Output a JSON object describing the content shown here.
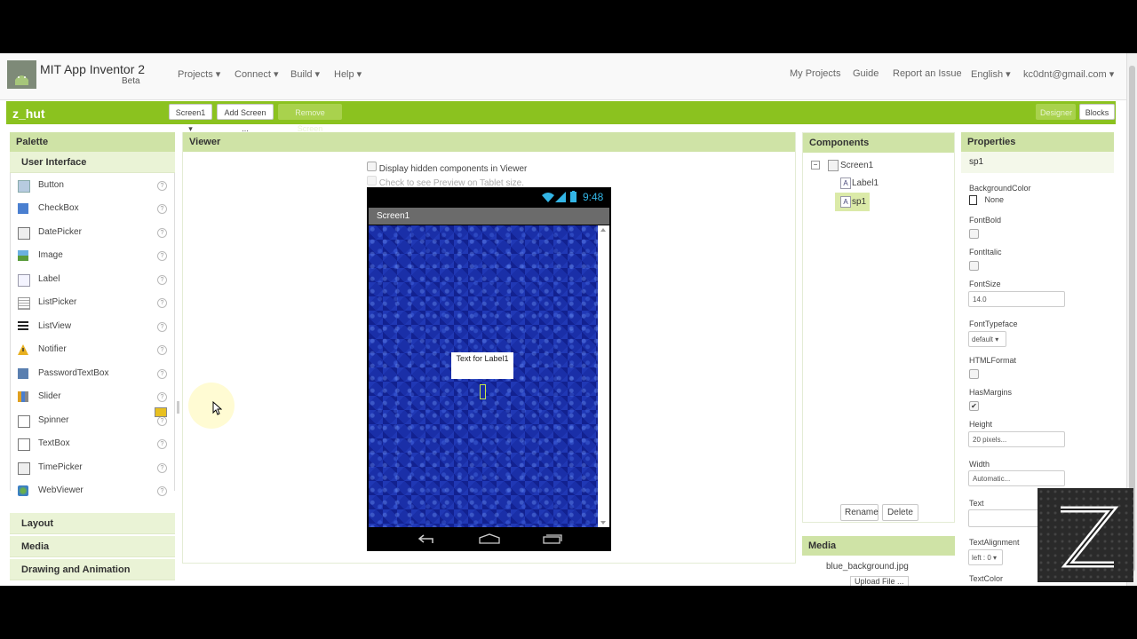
{
  "header": {
    "app_title": "MIT App Inventor 2",
    "app_sub": "Beta",
    "menus": [
      "Projects ▾",
      "Connect ▾",
      "Build ▾",
      "Help ▾"
    ],
    "right_links": [
      "My Projects",
      "Guide",
      "Report an Issue",
      "English ▾",
      "kc0dnt@gmail.com ▾"
    ]
  },
  "project": {
    "name": "z_hut",
    "screen_select": "Screen1 ▾",
    "add_screen": "Add Screen ...",
    "remove_screen": "Remove Screen",
    "designer": "Designer",
    "blocks": "Blocks"
  },
  "palette": {
    "title": "Palette",
    "category_open": "User Interface",
    "items": [
      {
        "label": "Button",
        "icon": "button-icon"
      },
      {
        "label": "CheckBox",
        "icon": "checkbox-icon"
      },
      {
        "label": "DatePicker",
        "icon": "datepicker-icon"
      },
      {
        "label": "Image",
        "icon": "image-icon"
      },
      {
        "label": "Label",
        "icon": "label-icon"
      },
      {
        "label": "ListPicker",
        "icon": "listpicker-icon"
      },
      {
        "label": "ListView",
        "icon": "listview-icon"
      },
      {
        "label": "Notifier",
        "icon": "notifier-icon"
      },
      {
        "label": "PasswordTextBox",
        "icon": "password-icon"
      },
      {
        "label": "Slider",
        "icon": "slider-icon"
      },
      {
        "label": "Spinner",
        "icon": "spinner-icon"
      },
      {
        "label": "TextBox",
        "icon": "textbox-icon"
      },
      {
        "label": "TimePicker",
        "icon": "timepicker-icon"
      },
      {
        "label": "WebViewer",
        "icon": "webviewer-icon"
      }
    ],
    "other_categories": [
      "Layout",
      "Media",
      "Drawing and Animation"
    ],
    "help_glyph": "?"
  },
  "viewer": {
    "title": "Viewer",
    "hidden_check": "Display hidden components in Viewer",
    "tablet_check": "Check to see Preview on Tablet size.",
    "time": "9:48",
    "screen_title": "Screen1",
    "label_text": "Text for Label1"
  },
  "components": {
    "title": "Components",
    "tree": [
      "Screen1",
      "Label1",
      "sp1"
    ],
    "selected": "sp1",
    "rename": "Rename",
    "delete": "Delete"
  },
  "media": {
    "title": "Media",
    "file": "blue_background.jpg",
    "upload": "Upload File ..."
  },
  "properties": {
    "title": "Properties",
    "component": "sp1",
    "bg_label": "BackgroundColor",
    "bg_value": "None",
    "fontbold": "FontBold",
    "fontitalic": "FontItalic",
    "fontsize": "FontSize",
    "fontsize_value": "14.0",
    "fonttypeface": "FontTypeface",
    "fonttypeface_value": "default ▾",
    "htmlformat": "HTMLFormat",
    "hasmargins": "HasMargins",
    "height": "Height",
    "height_value": "20 pixels...",
    "width": "Width",
    "width_value": "Automatic...",
    "text": "Text",
    "textalignment": "TextAlignment",
    "textalignment_value": "left : 0 ▾",
    "textcolor": "TextColor"
  },
  "colors": {
    "accent_green": "#8bc21f",
    "panel_head": "#cfe3a6",
    "screen_blue": "#1a2fa8"
  }
}
